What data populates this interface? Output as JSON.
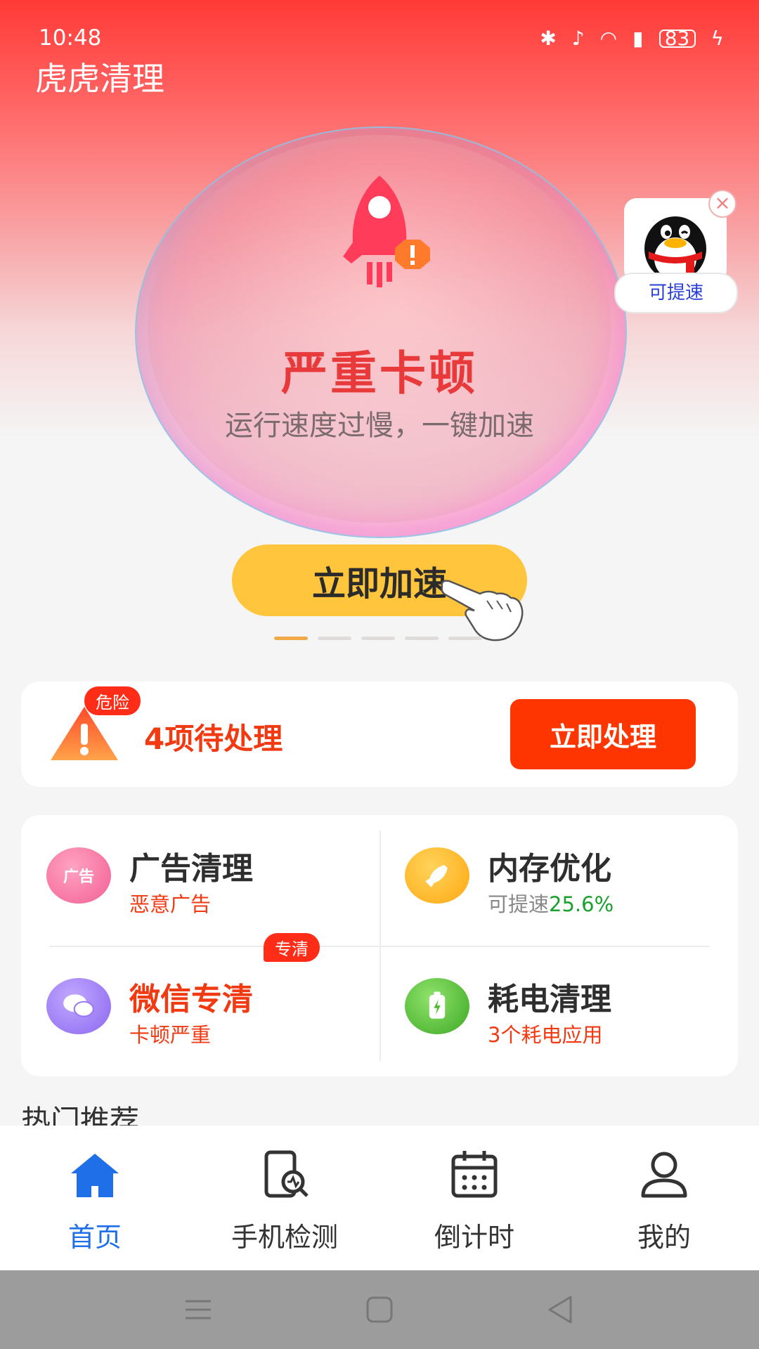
{
  "status_bar": {
    "time": "10:48",
    "battery": "83"
  },
  "app": {
    "title": "虎虎清理"
  },
  "hero": {
    "status_title": "严重卡顿",
    "status_subtitle": "运行速度过慢，一键加速",
    "boost_button": "立即加速",
    "page_count": 5,
    "active_page": 1
  },
  "float_widget": {
    "label": "可提速"
  },
  "alert": {
    "badge": "危险",
    "text": "4项待处理",
    "button": "立即处理"
  },
  "tools": [
    {
      "icon_label": "广告",
      "title": "广告清理",
      "subtitle": "恶意广告",
      "color": "#f772a2"
    },
    {
      "title": "内存优化",
      "subtitle_prefix": "可提速",
      "subtitle_value": "25.6%",
      "color": "#ffb11b"
    },
    {
      "title": "微信专清",
      "subtitle": "卡顿严重",
      "badge": "专清",
      "color": "#9a78f5"
    },
    {
      "title": "耗电清理",
      "subtitle": "3个耗电应用",
      "color": "#4dbb2f"
    }
  ],
  "section": {
    "hot": "热门推荐"
  },
  "tabs": [
    {
      "label": "首页",
      "icon": "home-icon",
      "active": true
    },
    {
      "label": "手机检测",
      "icon": "phone-check-icon",
      "active": false
    },
    {
      "label": "倒计时",
      "icon": "calendar-icon",
      "active": false
    },
    {
      "label": "我的",
      "icon": "user-icon",
      "active": false
    }
  ],
  "colors": {
    "accent": "#ff3500",
    "tab_active": "#1f6fe8",
    "boost": "#ffc53c"
  }
}
